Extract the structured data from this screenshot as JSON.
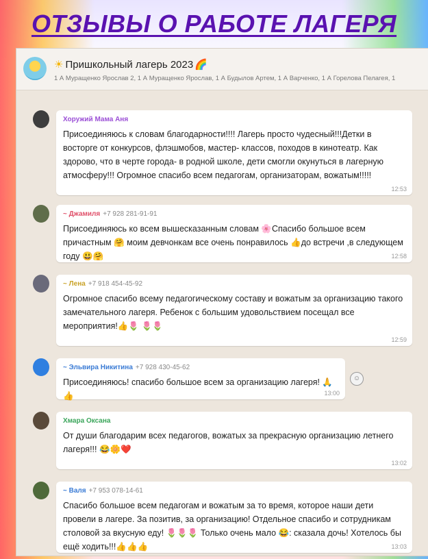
{
  "page_title": "ОТЗЫВЫ О РАБОТЕ ЛАГЕРЯ",
  "chat": {
    "title": "Пришкольный лагерь 2023",
    "title_prefix_emoji": "☀",
    "title_suffix_emoji": "🌈",
    "members": "1 А Муращенко Ярослав 2, 1 А Муращенко Ярослав, 1 А Будылов Артем, 1 А Варченко, 1 А Горелова Пелагея, 1"
  },
  "messages": [
    {
      "sender": "Хоружий Мама Аня",
      "phone": "",
      "sender_color": "#9b4fd6",
      "avatar_color": "#4a4a4a",
      "text": "Присоединяюсь к словам благодарности!!!! Лагерь просто чудесный!!!Детки в восторге от конкурсов, флэшмобов,  мастер- классов, походов в кинотеатр. Как здорово, что в черте города- в родной школе, дети смогли окунуться в лагерную атмосферу!!! Огромное спасибо всем педагогам, организаторам, вожатым!!!!!",
      "time": "12:53"
    },
    {
      "sender": "~ Джамиля",
      "phone": "+7 928 281-91-91",
      "sender_color": "#e0506a",
      "avatar_color": "#5f6d4a",
      "text": "Присоединяюсь ко всем вышесказанным словам 🌸Спасибо большое всем причастным 🤗 моим девчонкам все очень понравилось 👍до встречи ,в следующем году 😃🤗",
      "time": "12:58"
    },
    {
      "sender": "~ Лена",
      "phone": "+7 918 454-45-92",
      "sender_color": "#c9a227",
      "avatar_color": "#6a6a7a",
      "text": "Огромное спасибо всему педагогическому составу и вожатым за организацию такого замечательного лагеря. Ребенок с большим удовольствием посещал все мероприятия!👍🌷 🌷🌷",
      "time": "12:59"
    },
    {
      "sender": "~ Эльвира Никитина",
      "phone": "+7 928 430-45-62",
      "sender_color": "#3a7bd5",
      "avatar_color": "#2f7fe0",
      "text": "Присоединяюсь! спасибо большое всем за организацию лагеря! 🙏👍",
      "time": "13:00",
      "reply_icon": "☺"
    },
    {
      "sender": "Хмара Оксана",
      "phone": "",
      "sender_color": "#3aa55a",
      "avatar_color": "#5a4a3a",
      "text": "От души благодарим всех педагогов, вожатых за прекрасную организацию летнего лагеря!!! 😂🌼❤️",
      "time": "13:02"
    },
    {
      "sender": "~ Валя",
      "phone": "+7 953 078-14-61",
      "sender_color": "#3a7bd5",
      "avatar_color": "#4f6a3a",
      "text": "Спасибо большое всем педагогам и вожатым за то время, которое наши дети провели в лагере. За позитив, за организацию! Отдельное спасибо и сотрудникам столовой за вкусную еду! 🌷🌷🌷 Только очень мало 😂: сказала дочь! Хотелось бы ещё ходить!!!👍👍👍",
      "time": "13:03"
    }
  ]
}
